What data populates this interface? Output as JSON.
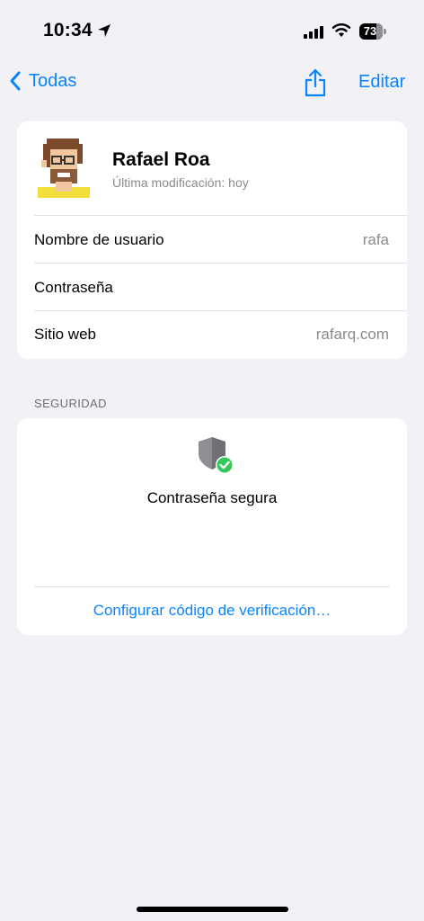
{
  "status_bar": {
    "time": "10:34",
    "battery": "73",
    "icons": [
      "location-arrow-icon",
      "cellular-signal-icon",
      "wifi-icon",
      "battery-icon"
    ]
  },
  "nav": {
    "back_label": "Todas",
    "edit_label": "Editar",
    "icons": [
      "chevron-left-icon",
      "share-icon"
    ]
  },
  "account": {
    "name": "Rafael Roa",
    "modified": "Última modificación: hoy",
    "rows": [
      {
        "label": "Nombre de usuario",
        "value": "rafa"
      },
      {
        "label": "Contraseña",
        "value": ""
      },
      {
        "label": "Sitio web",
        "value": "rafarq.com"
      }
    ]
  },
  "security": {
    "header": "SEGURIDAD",
    "status": "Contraseña segura",
    "link": "Configurar código de verificación…",
    "icon": "shield-check-icon"
  },
  "colors": {
    "accent": "#0A84FF",
    "background": "#F2F1F6",
    "success": "#34C759"
  }
}
